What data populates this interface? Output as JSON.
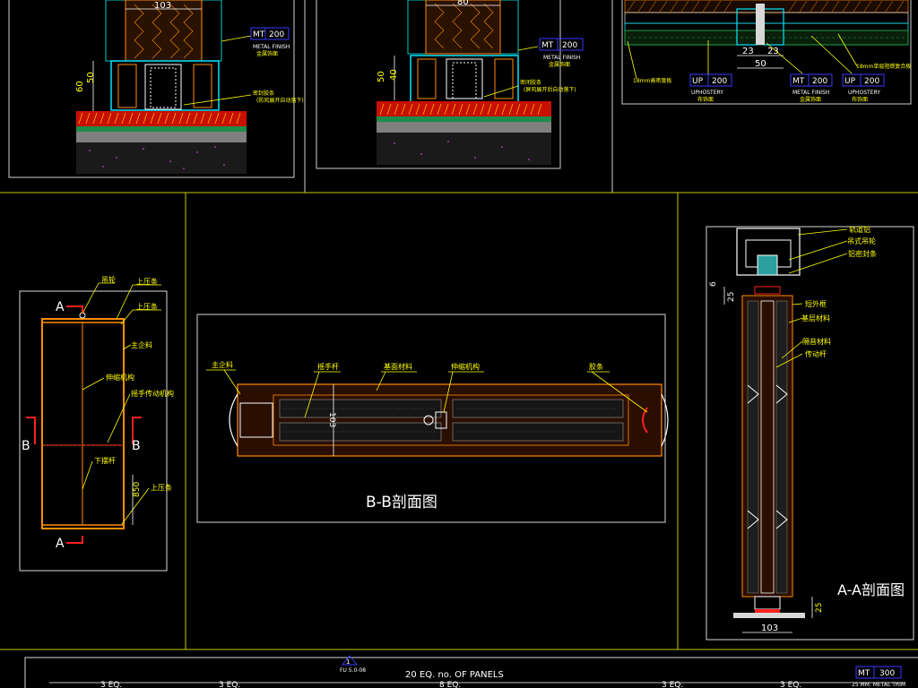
{
  "top_left": {
    "dims": {
      "d103": "103",
      "d60": "60",
      "d50": "50"
    },
    "tag": {
      "code": "MT",
      "num": "200",
      "en": "METAL FINISH",
      "cn": "金属饰面"
    },
    "note_cn": "密封胶条",
    "note_sub": "(防风展开自动落下)"
  },
  "top_mid": {
    "dims": {
      "d80": "80",
      "d50": "50",
      "d40": "40"
    },
    "tag": {
      "code": "MT",
      "num": "200",
      "en": "METAL FINISH",
      "cn": "金属饰面"
    },
    "note_cn": "密闭胶条",
    "note_sub": "(屏风展开后自动落下)"
  },
  "top_right": {
    "dims": {
      "d23a": "23",
      "d23b": "23",
      "d50": "50"
    },
    "tag_up1": {
      "code": "UP",
      "num": "200",
      "en": "UPHOSTERY",
      "cn": "布饰面"
    },
    "tag_mt": {
      "code": "MT",
      "num": "200",
      "en": "METAL FINISH",
      "cn": "金属饰面"
    },
    "tag_up2": {
      "code": "UP",
      "num": "200",
      "en": "UPHOSTERY",
      "cn": "布饰面"
    },
    "left_note": "18mm高密度板",
    "right_note": "18mm单层阻燃复合板"
  },
  "elevation": {
    "labels": {
      "hanging_wheel": "吊轮",
      "top_strip1": "上压条",
      "top_strip2": "上压条",
      "main_profile": "主企料",
      "telescopic": "伸缩机构",
      "handle_drive": "摇手传动机构",
      "bottom_bar": "下摆杆",
      "top_strip3": "上压条"
    },
    "markers": {
      "a_top": "A",
      "a_bottom": "A",
      "b_left": "B",
      "b_right": "B"
    },
    "dim_bottom": "850"
  },
  "section_bb": {
    "labels": {
      "main_profile": "主企料",
      "handle_rod": "摇手杆",
      "base_material": "基面材料",
      "telescopic": "伸缩机构",
      "rubber_strip": "胶条"
    },
    "dim": "103",
    "title": "B-B剖面图"
  },
  "section_aa": {
    "labels": {
      "track": "轨道铝",
      "hanging_wheel": "吊式吊轮",
      "seal_strip": "铝密封条",
      "short_frame": "短外框",
      "base_material": "基层材料",
      "sound_material": "隔音材料",
      "drive_rod": "传动杆"
    },
    "dims": {
      "top25": "25",
      "six": "6",
      "bottom25": "25",
      "width": "103"
    },
    "title": "A-A剖面图"
  },
  "bottom_strip": {
    "center_label": "20 EQ. no. OF PANELS",
    "ref_top": "1",
    "ref_code": "FU 5.0-08",
    "eq_labels": [
      "3 EQ.",
      "3 EQ.",
      "8 EQ.",
      "3 EQ.",
      "3 EQ."
    ],
    "tag": {
      "code": "MT",
      "num": "300",
      "note": "25 MM. METAL TRIM"
    }
  },
  "colors": {
    "bg": "#000000",
    "frame": "#d8d8d8",
    "leader": "#ffff00",
    "cyan": "#00e5ff",
    "orange": "#ff8c00",
    "red": "#ff2020",
    "blue": "#3a3aff",
    "green": "#1ea050",
    "magenta": "#ff40ff",
    "dark_brown": "#8a3a00"
  }
}
